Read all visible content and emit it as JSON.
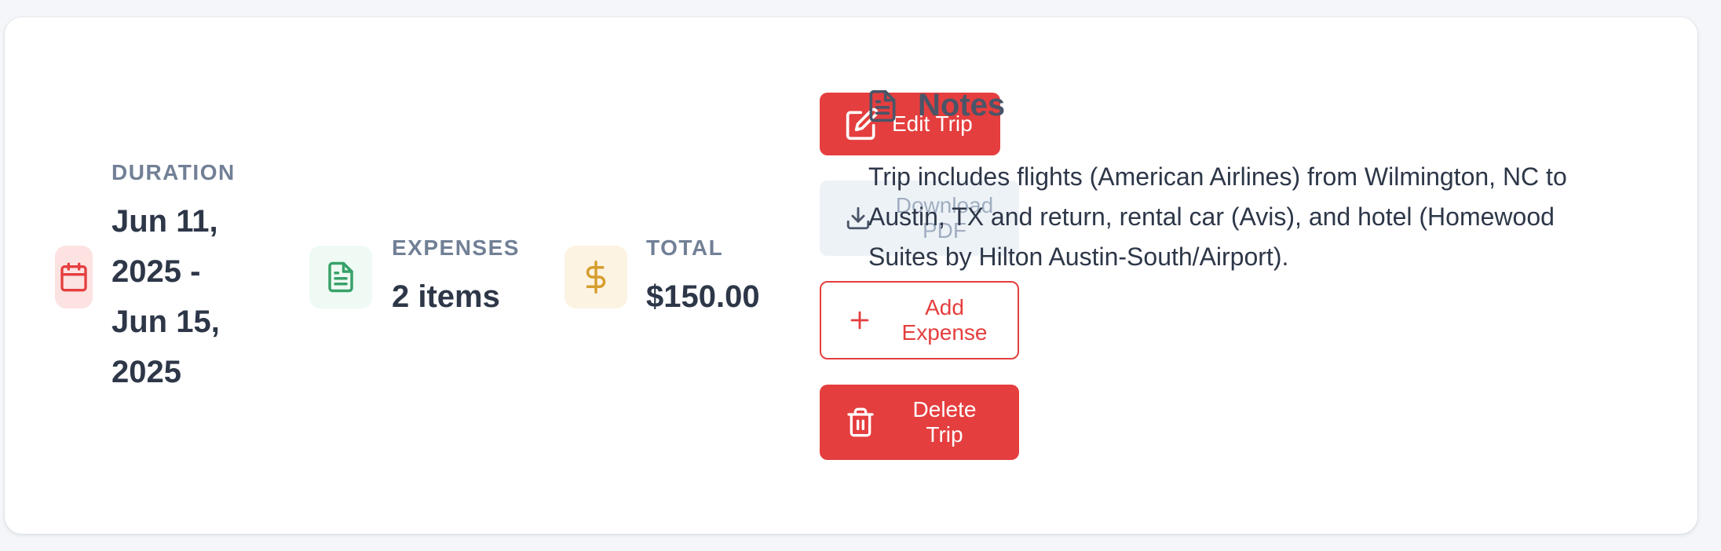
{
  "stats": {
    "duration": {
      "icon": "calendar-icon",
      "label": "DURATION",
      "lines": [
        "Jun 11,",
        "2025 -",
        "Jun 15,",
        "2025"
      ]
    },
    "expenses": {
      "icon": "document-icon",
      "label": "EXPENSES",
      "value": "2 items"
    },
    "total": {
      "icon": "dollar-icon",
      "label": "TOTAL",
      "value": "$150.00"
    }
  },
  "actions": {
    "edit_trip": {
      "label": "Edit Trip",
      "icon": "edit-icon"
    },
    "download_pdf": {
      "label_lines": [
        "Download",
        "PDF"
      ],
      "icon": "download-icon"
    },
    "add_expense": {
      "label_lines": [
        "Add",
        "Expense"
      ],
      "icon": "plus-icon"
    },
    "delete_trip": {
      "label_lines": [
        "Delete",
        "Trip"
      ],
      "icon": "trash-icon"
    }
  },
  "notes": {
    "icon": "notes-icon",
    "title": "Notes",
    "lines": [
      "Trip includes flights (American Airlines) from Wilmington, NC to",
      "Austin, TX and return, rental car (Avis), and hotel (Homewood",
      "Suites by Hilton Austin-South/Airport)."
    ]
  },
  "colors": {
    "accent_red": "#e53e3e",
    "calendar_bg": "#fde2e2",
    "expenses_bg": "#eefaf3",
    "expenses_icon": "#38a169",
    "total_bg": "#fdf3e3",
    "total_icon": "#d69e2e",
    "label_gray": "#718096",
    "text_dark": "#2d3748"
  }
}
